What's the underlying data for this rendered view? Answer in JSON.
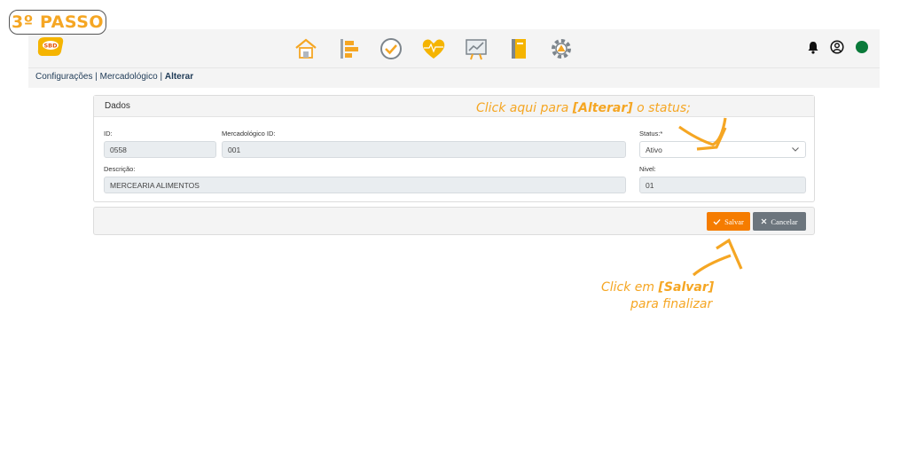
{
  "badge": {
    "text": "3º PASSO"
  },
  "header": {
    "logo_text": "SBD",
    "nav_icons": [
      "home-icon",
      "hierarchy-icon",
      "check-circle-icon",
      "heart-pulse-icon",
      "chart-board-icon",
      "notebook-icon",
      "settings-gear-icon"
    ],
    "right_icons": [
      "bell-icon",
      "user-circle-icon",
      "status-dot-icon"
    ],
    "status_color": "#0a7a3a",
    "accent_color": "#f5a623"
  },
  "breadcrumb": {
    "items": [
      "Configurações",
      "Mercadológico"
    ],
    "separator": " | ",
    "current": "Alterar"
  },
  "form": {
    "title": "Dados",
    "id_label": "ID:",
    "id_value": "0558",
    "mercadologico_label": "Mercadológico ID:",
    "mercadologico_value": "001",
    "status_label": "Status:*",
    "status_value": "Ativo",
    "descricao_label": "Descrição:",
    "descricao_value": "MERCEARIA ALIMENTOS",
    "nivel_label": "Nivel:",
    "nivel_value": "01"
  },
  "actions": {
    "save_label": "Salvar",
    "cancel_label": "Cancelar",
    "save_color": "#f57c00",
    "cancel_color": "#6c757d"
  },
  "annotations": {
    "status_prefix": "Click aqui para ",
    "status_emph": "[Alterar]",
    "status_suffix": " o status;",
    "save_prefix": "Click em ",
    "save_emph": "[Salvar]",
    "save_line2": "para finalizar"
  }
}
